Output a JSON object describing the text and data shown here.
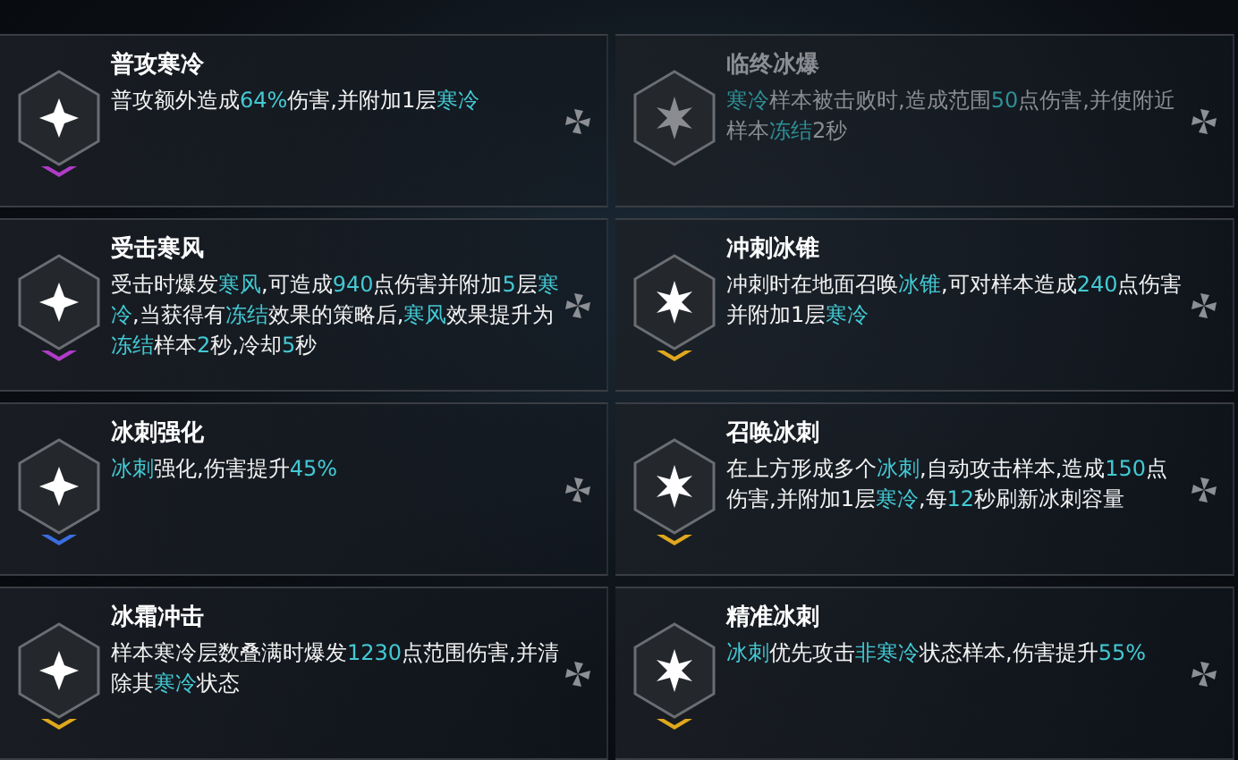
{
  "cards": [
    {
      "title": "普攻寒冷",
      "disabled": false,
      "color": "#b03cc8",
      "desc": [
        {
          "text": "普攻额外造成",
          "highlight": false
        },
        {
          "text": "64%",
          "highlight": true
        },
        {
          "text": "伤害,并附加1层",
          "highlight": false
        },
        {
          "text": "寒冷",
          "highlight": true
        }
      ]
    },
    {
      "title": "临终冰爆",
      "disabled": true,
      "desc": [
        {
          "text": "寒冷",
          "highlight": true
        },
        {
          "text": "样本被击败时,造成范围",
          "highlight": false
        },
        {
          "text": "50",
          "highlight": true
        },
        {
          "text": "点伤害,并使附近样本",
          "highlight": false
        },
        {
          "text": "冻结",
          "highlight": true
        },
        {
          "text": "2秒",
          "highlight": false
        }
      ]
    },
    {
      "title": "受击寒风",
      "disabled": false,
      "color": "#b03cc8",
      "desc": [
        {
          "text": "受击时爆发",
          "highlight": false
        },
        {
          "text": "寒风",
          "highlight": true
        },
        {
          "text": ",可造成",
          "highlight": false
        },
        {
          "text": "940",
          "highlight": true
        },
        {
          "text": "点伤害并附加",
          "highlight": false
        },
        {
          "text": "5",
          "highlight": true
        },
        {
          "text": "层",
          "highlight": false
        },
        {
          "text": "寒冷",
          "highlight": true
        },
        {
          "text": ",当获得有",
          "highlight": false
        },
        {
          "text": "冻结",
          "highlight": true
        },
        {
          "text": "效果的策略后,",
          "highlight": false
        },
        {
          "text": "寒风",
          "highlight": true
        },
        {
          "text": "效果提升为",
          "highlight": false
        },
        {
          "text": "冻结",
          "highlight": true
        },
        {
          "text": "样本",
          "highlight": false
        },
        {
          "text": "2",
          "highlight": true
        },
        {
          "text": "秒,冷却",
          "highlight": false
        },
        {
          "text": "5",
          "highlight": true
        },
        {
          "text": "秒",
          "highlight": false
        }
      ]
    },
    {
      "title": "冲刺冰锥",
      "disabled": false,
      "color": "#e0a81c",
      "desc": [
        {
          "text": "冲刺时在地面召唤",
          "highlight": false
        },
        {
          "text": "冰锥",
          "highlight": true
        },
        {
          "text": ",可对样本造成",
          "highlight": false
        },
        {
          "text": "240",
          "highlight": true
        },
        {
          "text": "点伤害并附加1层",
          "highlight": false
        },
        {
          "text": "寒冷",
          "highlight": true
        }
      ]
    },
    {
      "title": "冰刺强化",
      "disabled": false,
      "color": "#3a6ee0",
      "desc": [
        {
          "text": "冰刺",
          "highlight": true
        },
        {
          "text": "强化,伤害提升",
          "highlight": false
        },
        {
          "text": "45%",
          "highlight": true
        }
      ]
    },
    {
      "title": "召唤冰刺",
      "disabled": false,
      "color": "#e0a81c",
      "desc": [
        {
          "text": "在上方形成多个",
          "highlight": false
        },
        {
          "text": "冰刺",
          "highlight": true
        },
        {
          "text": ",自动攻击样本,造成",
          "highlight": false
        },
        {
          "text": "150",
          "highlight": true
        },
        {
          "text": "点伤害,并附加1层",
          "highlight": false
        },
        {
          "text": "寒冷",
          "highlight": true
        },
        {
          "text": ",每",
          "highlight": false
        },
        {
          "text": "12",
          "highlight": true
        },
        {
          "text": "秒刷新冰刺容量",
          "highlight": false
        }
      ]
    },
    {
      "title": "冰霜冲击",
      "disabled": false,
      "color": "#e0a81c",
      "desc": [
        {
          "text": "样本寒冷层数叠满时爆发",
          "highlight": false
        },
        {
          "text": "1230",
          "highlight": true
        },
        {
          "text": "点范围伤害,并清除其",
          "highlight": false
        },
        {
          "text": "寒冷",
          "highlight": true
        },
        {
          "text": "状态",
          "highlight": false
        }
      ]
    },
    {
      "title": "精准冰刺",
      "disabled": false,
      "color": "#e0a81c",
      "desc": [
        {
          "text": "冰刺",
          "highlight": true
        },
        {
          "text": "优先攻击",
          "highlight": false
        },
        {
          "text": "非寒冷",
          "highlight": true
        },
        {
          "text": "状态样本,伤害提升",
          "highlight": false
        },
        {
          "text": "55%",
          "highlight": true
        }
      ]
    }
  ]
}
